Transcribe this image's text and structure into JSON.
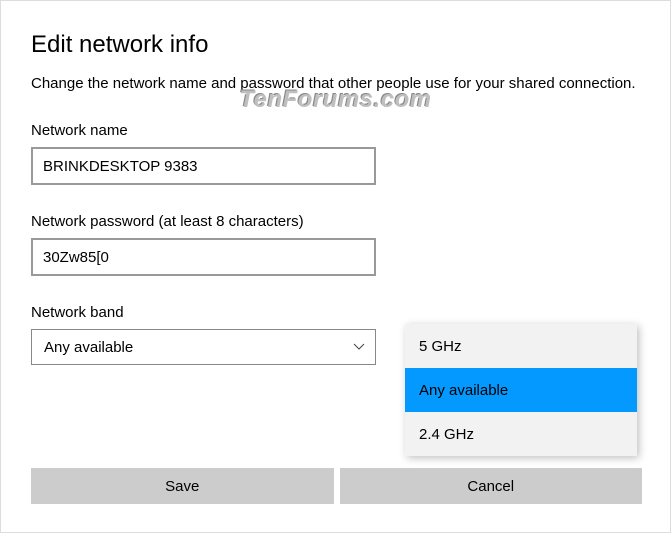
{
  "title": "Edit network info",
  "description": "Change the network name and password that other people use for your shared connection.",
  "watermark": "TenForums.com",
  "fields": {
    "name": {
      "label": "Network name",
      "value": "BRINKDESKTOP 9383"
    },
    "password": {
      "label": "Network password (at least 8 characters)",
      "value": "30Zw85[0"
    },
    "band": {
      "label": "Network band",
      "value": "Any available"
    }
  },
  "dropdown": {
    "options": [
      "5 GHz",
      "Any available",
      "2.4 GHz"
    ],
    "selected": "Any available"
  },
  "buttons": {
    "save": "Save",
    "cancel": "Cancel"
  }
}
